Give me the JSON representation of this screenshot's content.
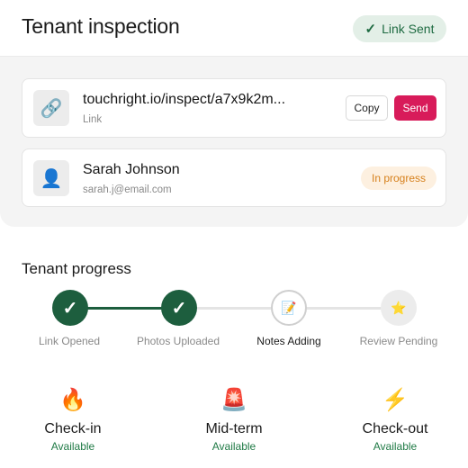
{
  "header": {
    "title": "Tenant inspection",
    "status_badge": {
      "icon": "check-icon",
      "label": "Link Sent"
    }
  },
  "link_card": {
    "icon": "link-icon",
    "url": "touchright.io/inspect/a7x9k2m...",
    "caption": "Link",
    "copy_label": "Copy",
    "send_label": "Send"
  },
  "tenant_card": {
    "icon": "person-avatar-icon",
    "name": "Sarah Johnson",
    "email": "sarah.j@email.com",
    "status": "In progress"
  },
  "progress": {
    "title": "Tenant progress",
    "steps": [
      {
        "label": "Link Opened",
        "state": "done",
        "icon": "check-icon"
      },
      {
        "label": "Photos Uploaded",
        "state": "done",
        "icon": "check-icon"
      },
      {
        "label": "Notes Adding",
        "state": "current",
        "icon": "notepad-icon"
      },
      {
        "label": "Review Pending",
        "state": "pending",
        "icon": "star-icon"
      }
    ]
  },
  "inspection_types": [
    {
      "icon": "fire-icon",
      "name": "Check-in",
      "status": "Available"
    },
    {
      "icon": "siren-icon",
      "name": "Mid-term",
      "status": "Available"
    },
    {
      "icon": "lightning-icon",
      "name": "Check-out",
      "status": "Available"
    }
  ],
  "colors": {
    "accent_pink": "#d81b5a",
    "done_green": "#1d5e3e",
    "available_green": "#1f7a45",
    "in_progress_orange": "#d6801c",
    "sent_badge_bg": "#e3efe7"
  }
}
